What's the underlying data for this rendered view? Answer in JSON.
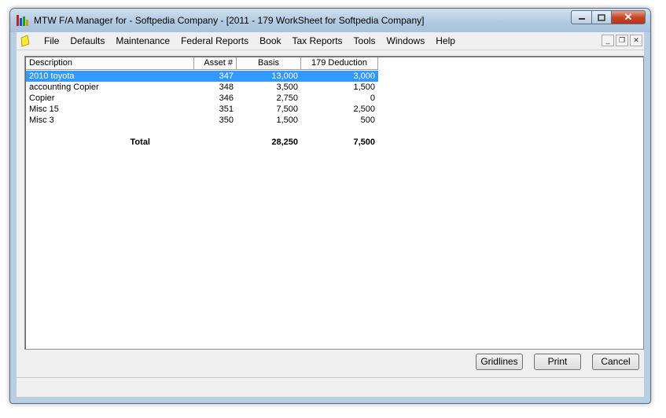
{
  "window": {
    "title": "MTW F/A Manager for - Softpedia Company - [2011 - 179 WorkSheet for Softpedia Company]"
  },
  "menu": {
    "items": [
      "File",
      "Defaults",
      "Maintenance",
      "Federal Reports",
      "Book",
      "Tax Reports",
      "Tools",
      "Windows",
      "Help"
    ]
  },
  "table": {
    "columns": [
      "Description",
      "Asset #",
      "Basis",
      "179 Deduction"
    ],
    "rows": [
      {
        "description": "2010 toyota",
        "asset": "347",
        "basis": "13,000",
        "deduction": "3,000",
        "selected": true
      },
      {
        "description": "accounting Copier",
        "asset": "348",
        "basis": "3,500",
        "deduction": "1,500"
      },
      {
        "description": "Copier",
        "asset": "346",
        "basis": "2,750",
        "deduction": "0"
      },
      {
        "description": "Misc 15",
        "asset": "351",
        "basis": "7,500",
        "deduction": "2,500"
      },
      {
        "description": "Misc 3",
        "asset": "350",
        "basis": "1,500",
        "deduction": "500"
      }
    ],
    "total": {
      "label": "Total",
      "basis": "28,250",
      "deduction": "7,500"
    }
  },
  "buttons": {
    "gridlines": "Gridlines",
    "print": "Print",
    "cancel": "Cancel"
  },
  "colors": {
    "selection": "#3399ff",
    "close_button": "#c7462a"
  }
}
